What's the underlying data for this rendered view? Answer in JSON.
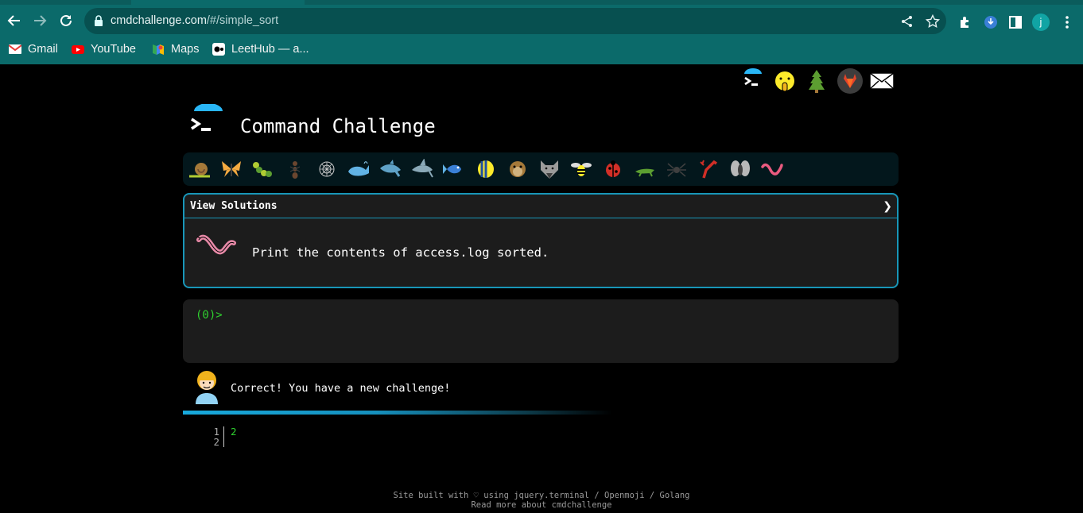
{
  "browser": {
    "url_host": "cmdchallenge.com",
    "url_path": "/#/simple_sort",
    "profile_initial": "j",
    "bookmarks": [
      {
        "label": "Gmail",
        "icon": "gmail-icon"
      },
      {
        "label": "YouTube",
        "icon": "youtube-icon"
      },
      {
        "label": "Maps",
        "icon": "maps-icon"
      },
      {
        "label": "LeetHub — a...",
        "icon": "leethub-icon"
      }
    ]
  },
  "header": {
    "title": "Command Challenge",
    "top_links": [
      "terminal-logo-icon",
      "shushing-face-icon",
      "tree-icon",
      "gitlab-icon",
      "mail-icon"
    ]
  },
  "critters": [
    "snail",
    "butterfly",
    "caterpillar",
    "ant",
    "spider-web",
    "whale",
    "shark",
    "dolphin",
    "fish",
    "tropical-fish",
    "blowfish",
    "wolf",
    "bee",
    "ladybug",
    "cricket",
    "spider",
    "scorpion",
    "fly",
    "worm"
  ],
  "challenge": {
    "view_solutions": "View Solutions",
    "chevron": "❯",
    "description": "Print the contents of access.log sorted."
  },
  "terminal": {
    "prompt": "(0)>"
  },
  "feedback": {
    "message": "Correct! You have a new challenge!"
  },
  "editor": {
    "line_numbers": [
      "1",
      "2"
    ],
    "lines": [
      "2",
      ""
    ]
  },
  "footer": {
    "line1": "Site built with ♡ using jquery.terminal / Openmoji / Golang",
    "line2": "Read more about cmdchallenge"
  },
  "colors": {
    "chrome_bg": "#0b6a6a",
    "accent": "#1896b8",
    "prompt_green": "#2fd02f"
  }
}
